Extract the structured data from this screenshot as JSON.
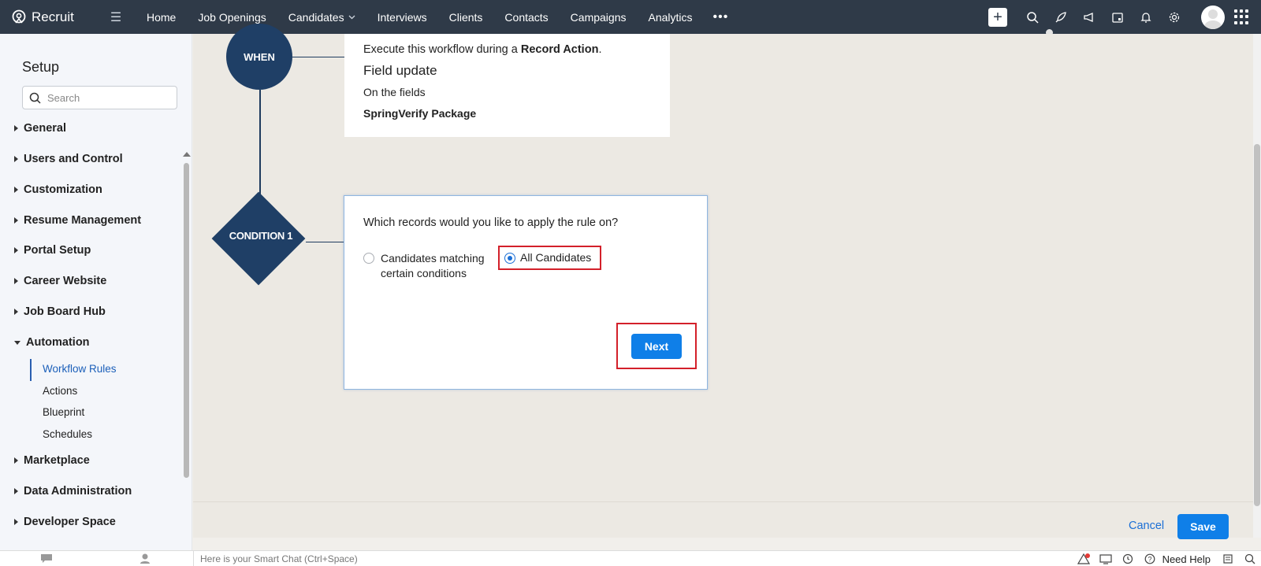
{
  "brand": {
    "name": "Recruit"
  },
  "nav": {
    "items": [
      "Home",
      "Job Openings",
      "Candidates",
      "Interviews",
      "Clients",
      "Contacts",
      "Campaigns",
      "Analytics"
    ],
    "more": "•••"
  },
  "sidebar": {
    "title": "Setup",
    "search_placeholder": "Search",
    "menu": [
      "General",
      "Users and Control",
      "Customization",
      "Resume Management",
      "Portal Setup",
      "Career Website",
      "Job Board Hub",
      "Automation",
      "Marketplace",
      "Data Administration",
      "Developer Space"
    ],
    "automation_sub": [
      "Workflow Rules",
      "Actions",
      "Blueprint",
      "Schedules"
    ],
    "active_sub": "Workflow Rules"
  },
  "workflow": {
    "when_label": "WHEN",
    "when_card": {
      "line1_prefix": "Execute this workflow during a ",
      "line1_bold": "Record Action",
      "line1_suffix": ".",
      "trigger": "Field update",
      "fields_label": "On the fields",
      "field_name": "SpringVerify Package"
    },
    "condition_label": "CONDITION 1",
    "condition_card": {
      "question": "Which records would you like to apply the rule on?",
      "option_matching": "Candidates matching certain conditions",
      "option_all": "All Candidates",
      "selected": "All Candidates",
      "next_label": "Next"
    }
  },
  "footer": {
    "cancel_label": "Cancel",
    "save_label": "Save"
  },
  "bottom": {
    "smart_chat": "Here is your Smart Chat (Ctrl+Space)",
    "need_help": "Need Help"
  },
  "colors": {
    "topbar": "#2f3a48",
    "node": "#1f3f66",
    "primary_button": "#0f7fe8",
    "highlight": "#d3202a",
    "link": "#1b6fd6"
  }
}
